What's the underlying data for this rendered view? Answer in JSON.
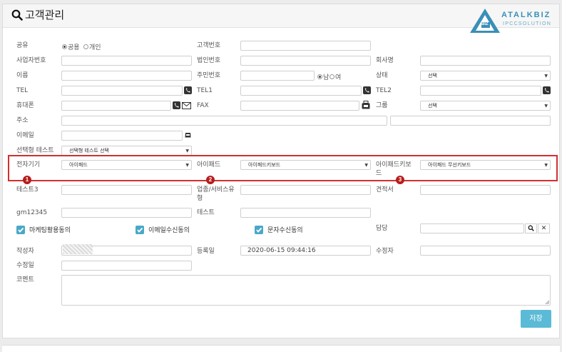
{
  "header": {
    "title": "고객관리"
  },
  "logo": {
    "brand": "ATALKBIZ",
    "sub": "IPCCSOLUTION",
    "mark": "BIZ"
  },
  "form": {
    "share": {
      "label": "공유",
      "opt_public": "공용",
      "opt_private": "개인"
    },
    "customer_no": {
      "label": "고객번호",
      "value": ""
    },
    "biz_no": {
      "label": "사업자번호",
      "value": ""
    },
    "corp_no": {
      "label": "법인번호",
      "value": ""
    },
    "company": {
      "label": "회사명",
      "value": ""
    },
    "name": {
      "label": "이름",
      "value": ""
    },
    "resident_no": {
      "label": "주민번호",
      "value": ""
    },
    "gender": {
      "male": "남",
      "female": "여"
    },
    "status": {
      "label": "상태",
      "value": "선택"
    },
    "tel": {
      "label": "TEL",
      "value": ""
    },
    "tel1": {
      "label": "TEL1",
      "value": ""
    },
    "tel2": {
      "label": "TEL2",
      "value": ""
    },
    "mobile": {
      "label": "휴대폰",
      "value": ""
    },
    "fax": {
      "label": "FAX",
      "value": ""
    },
    "group": {
      "label": "그룹",
      "value": "선택"
    },
    "address": {
      "label": "주소",
      "value": ""
    },
    "email": {
      "label": "이메일",
      "value": ""
    },
    "select_test": {
      "label": "선택형 테스트",
      "value": "선택형 테스트 선택"
    },
    "device": {
      "label": "전자기기",
      "value": "아이패드"
    },
    "ipad": {
      "label": "아이패드",
      "value": "아이패드키보드"
    },
    "ipad_kb": {
      "label": "아이패드키보",
      "label2": "드",
      "value": "아이패드 무선키보드"
    },
    "test3": {
      "label": "테스트3",
      "value": ""
    },
    "industry": {
      "label": "업종/서비스유",
      "label2": "형",
      "value": ""
    },
    "quote": {
      "label": "견적서",
      "value": ""
    },
    "gm": {
      "label": "gm12345",
      "value": ""
    },
    "test": {
      "label": "테스트",
      "value": ""
    },
    "consent_marketing": {
      "label": "마케팅활용동의"
    },
    "consent_email": {
      "label": "이메일수신동의"
    },
    "consent_sms": {
      "label": "문자수신동의"
    },
    "manager": {
      "label": "담당",
      "value": ""
    },
    "author": {
      "label": "작성자",
      "value": ""
    },
    "reg_date": {
      "label": "등록일",
      "value": "2020-06-15 09:44:16"
    },
    "editor": {
      "label": "수정자",
      "value": ""
    },
    "edit_date": {
      "label": "수정일",
      "value": ""
    },
    "comment": {
      "label": "코멘트",
      "value": ""
    },
    "save_label": "저장"
  },
  "badges": [
    "1",
    "2",
    "3"
  ],
  "colors": {
    "accent": "#5bbad5",
    "checkbox": "#4aa8c9",
    "highlight": "#d32f2f",
    "badge": "#b71c1c"
  }
}
